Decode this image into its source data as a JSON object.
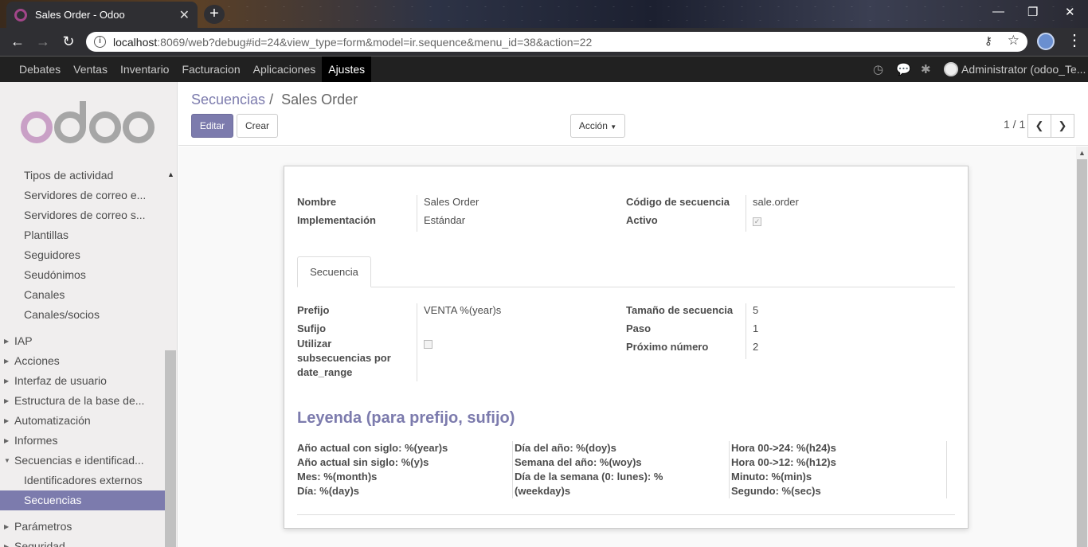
{
  "browser": {
    "tab_title": "Sales Order - Odoo",
    "url_host": "localhost",
    "url_rest": ":8069/web?debug#id=24&view_type=form&model=ir.sequence&menu_id=38&action=22"
  },
  "topnav": {
    "menu": [
      "Debates",
      "Ventas",
      "Inventario",
      "Facturacion",
      "Aplicaciones",
      "Ajustes"
    ],
    "active": "Ajustes",
    "user": "Administrator (odoo_Te..."
  },
  "sidebar": {
    "sub_items_top": [
      "Tipos de actividad",
      "Servidores de correo e...",
      "Servidores de correo s...",
      "Plantillas",
      "Seguidores",
      "Seudónimos",
      "Canales",
      "Canales/socios"
    ],
    "groups": [
      "IAP",
      "Acciones",
      "Interfaz de usuario",
      "Estructura de la base de...",
      "Automatización",
      "Informes",
      "Secuencias e identificad..."
    ],
    "sub_items_bottom": [
      "Identificadores externos",
      "Secuencias"
    ],
    "groups_after": [
      "Parámetros",
      "Seguridad"
    ]
  },
  "control": {
    "breadcrumb_parent": "Secuencias",
    "breadcrumb_sep": "/",
    "breadcrumb_current": "Sales Order",
    "edit_label": "Editar",
    "create_label": "Crear",
    "action_label": "Acción",
    "pager": "1 / 1"
  },
  "form": {
    "nombre_label": "Nombre",
    "nombre_value": "Sales Order",
    "implementacion_label": "Implementación",
    "implementacion_value": "Estándar",
    "codigo_label": "Código de secuencia",
    "codigo_value": "sale.order",
    "activo_label": "Activo",
    "activo_checked": true,
    "tab_label": "Secuencia",
    "prefijo_label": "Prefijo",
    "prefijo_value": "VENTA %(year)s",
    "sufijo_label": "Sufijo",
    "utilizar_label_1": "Utilizar",
    "utilizar_label_2": "subsecuencias por",
    "utilizar_label_3": "date_range",
    "utilizar_checked": false,
    "tamano_label": "Tamaño de secuencia",
    "tamano_value": "5",
    "paso_label": "Paso",
    "paso_value": "1",
    "proximo_label": "Próximo número",
    "proximo_value": "2"
  },
  "legend": {
    "title": "Leyenda (para prefijo, sufijo)",
    "col1": [
      "Año actual con siglo: %(year)s",
      "Año actual sin siglo: %(y)s",
      "Mes: %(month)s",
      "Día: %(day)s"
    ],
    "col2": [
      "Día del año: %(doy)s",
      "Semana del año: %(woy)s",
      "Día de la semana (0: lunes): %",
      "(weekday)s"
    ],
    "col3": [
      "Hora 00->24: %(h24)s",
      "Hora 00->12: %(h12)s",
      "Minuto: %(min)s",
      "Segundo: %(sec)s"
    ]
  },
  "colors": {
    "accent": "#7c7bad",
    "navbar": "#212121"
  }
}
